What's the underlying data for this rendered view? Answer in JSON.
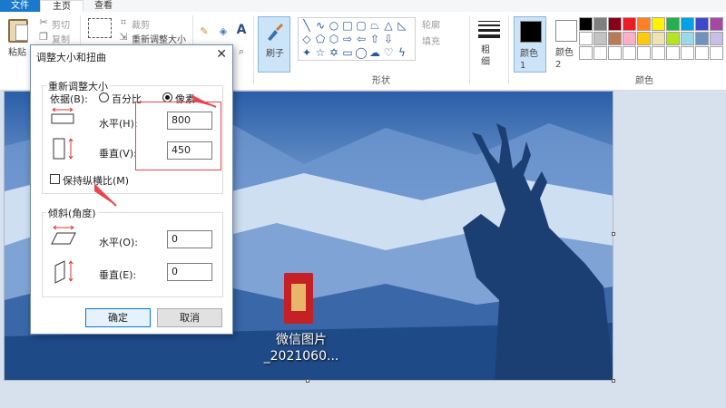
{
  "tabs": [
    {
      "label": "文件"
    },
    {
      "label": "主页"
    },
    {
      "label": "查看"
    }
  ],
  "ribbon": {
    "clipboard": {
      "paste_label": "粘贴",
      "cut_label": "剪切",
      "copy_label": "复制"
    },
    "image": {
      "crop_label": "裁剪",
      "resize_label": "重新调整大小"
    },
    "brush": {
      "label": "刷子"
    },
    "shapes": {
      "outline_label": "轮廓",
      "fill_label": "填充",
      "group_label": "形状"
    },
    "size": {
      "label": "粗细"
    },
    "colors": {
      "color1_label": "颜色 1",
      "color2_label": "颜色 2",
      "group_label": "颜色"
    },
    "palette": [
      "#000000",
      "#7f7f7f",
      "#880015",
      "#ed1c24",
      "#ff7f27",
      "#fff200",
      "#22b14c",
      "#00a2e8",
      "#3f48cc",
      "#a349a4",
      "#ffffff",
      "#c3c3c3",
      "#b97a57",
      "#ffaec9",
      "#ffc90e",
      "#efe4b0",
      "#b5e61d",
      "#99d9ea",
      "#7092be",
      "#c8bfe7",
      "#ffffff",
      "#ffffff",
      "#ffffff",
      "#ffffff",
      "#ffffff",
      "#ffffff",
      "#ffffff",
      "#ffffff",
      "#ffffff",
      "#ffffff"
    ]
  },
  "desktop_icon": {
    "label_line1": "微信图片",
    "label_line2": "_2021060..."
  },
  "dialog": {
    "title": "调整大小和扭曲",
    "close_glyph": "✕",
    "resize": {
      "section_title": "重新调整大小",
      "by_label": "依据(B):",
      "percent_label": "百分比",
      "pixels_label": "像素",
      "selected": "pixels",
      "horizontal_label": "水平(H):",
      "horizontal_value": "800",
      "vertical_label": "垂直(V):",
      "vertical_value": "450",
      "keep_ratio_label": "保持纵横比(M)",
      "keep_ratio_checked": false
    },
    "skew": {
      "section_title": "倾斜(角度)",
      "horizontal_label": "水平(O):",
      "horizontal_value": "0",
      "vertical_label": "垂直(E):",
      "vertical_value": "0"
    },
    "ok_label": "确定",
    "cancel_label": "取消"
  },
  "colors": {
    "accent": "#1979ca",
    "highlight": "#e8474e",
    "canvas_dark": "#1f4a88"
  }
}
